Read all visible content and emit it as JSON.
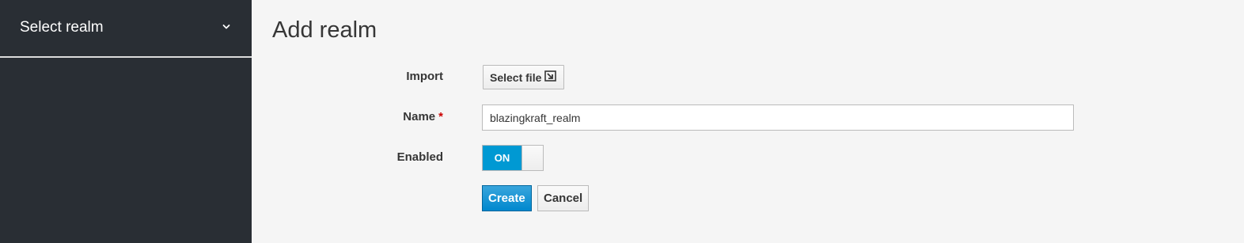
{
  "sidebar": {
    "realm_select_label": "Select realm",
    "chevron_icon": "chevron-down-icon"
  },
  "page": {
    "title": "Add realm"
  },
  "form": {
    "import_label": "Import",
    "select_file_label": "Select file",
    "select_file_icon": "import-file-icon",
    "name_label": "Name",
    "name_required_marker": "*",
    "name_value": "blazingkraft_realm",
    "enabled_label": "Enabled",
    "enabled_toggle_label": "ON",
    "enabled": true,
    "create_label": "Create",
    "cancel_label": "Cancel"
  },
  "colors": {
    "sidebar_bg": "#292e34",
    "accent": "#0088ce",
    "toggle_on": "#0099d3",
    "required": "#cc0000"
  }
}
